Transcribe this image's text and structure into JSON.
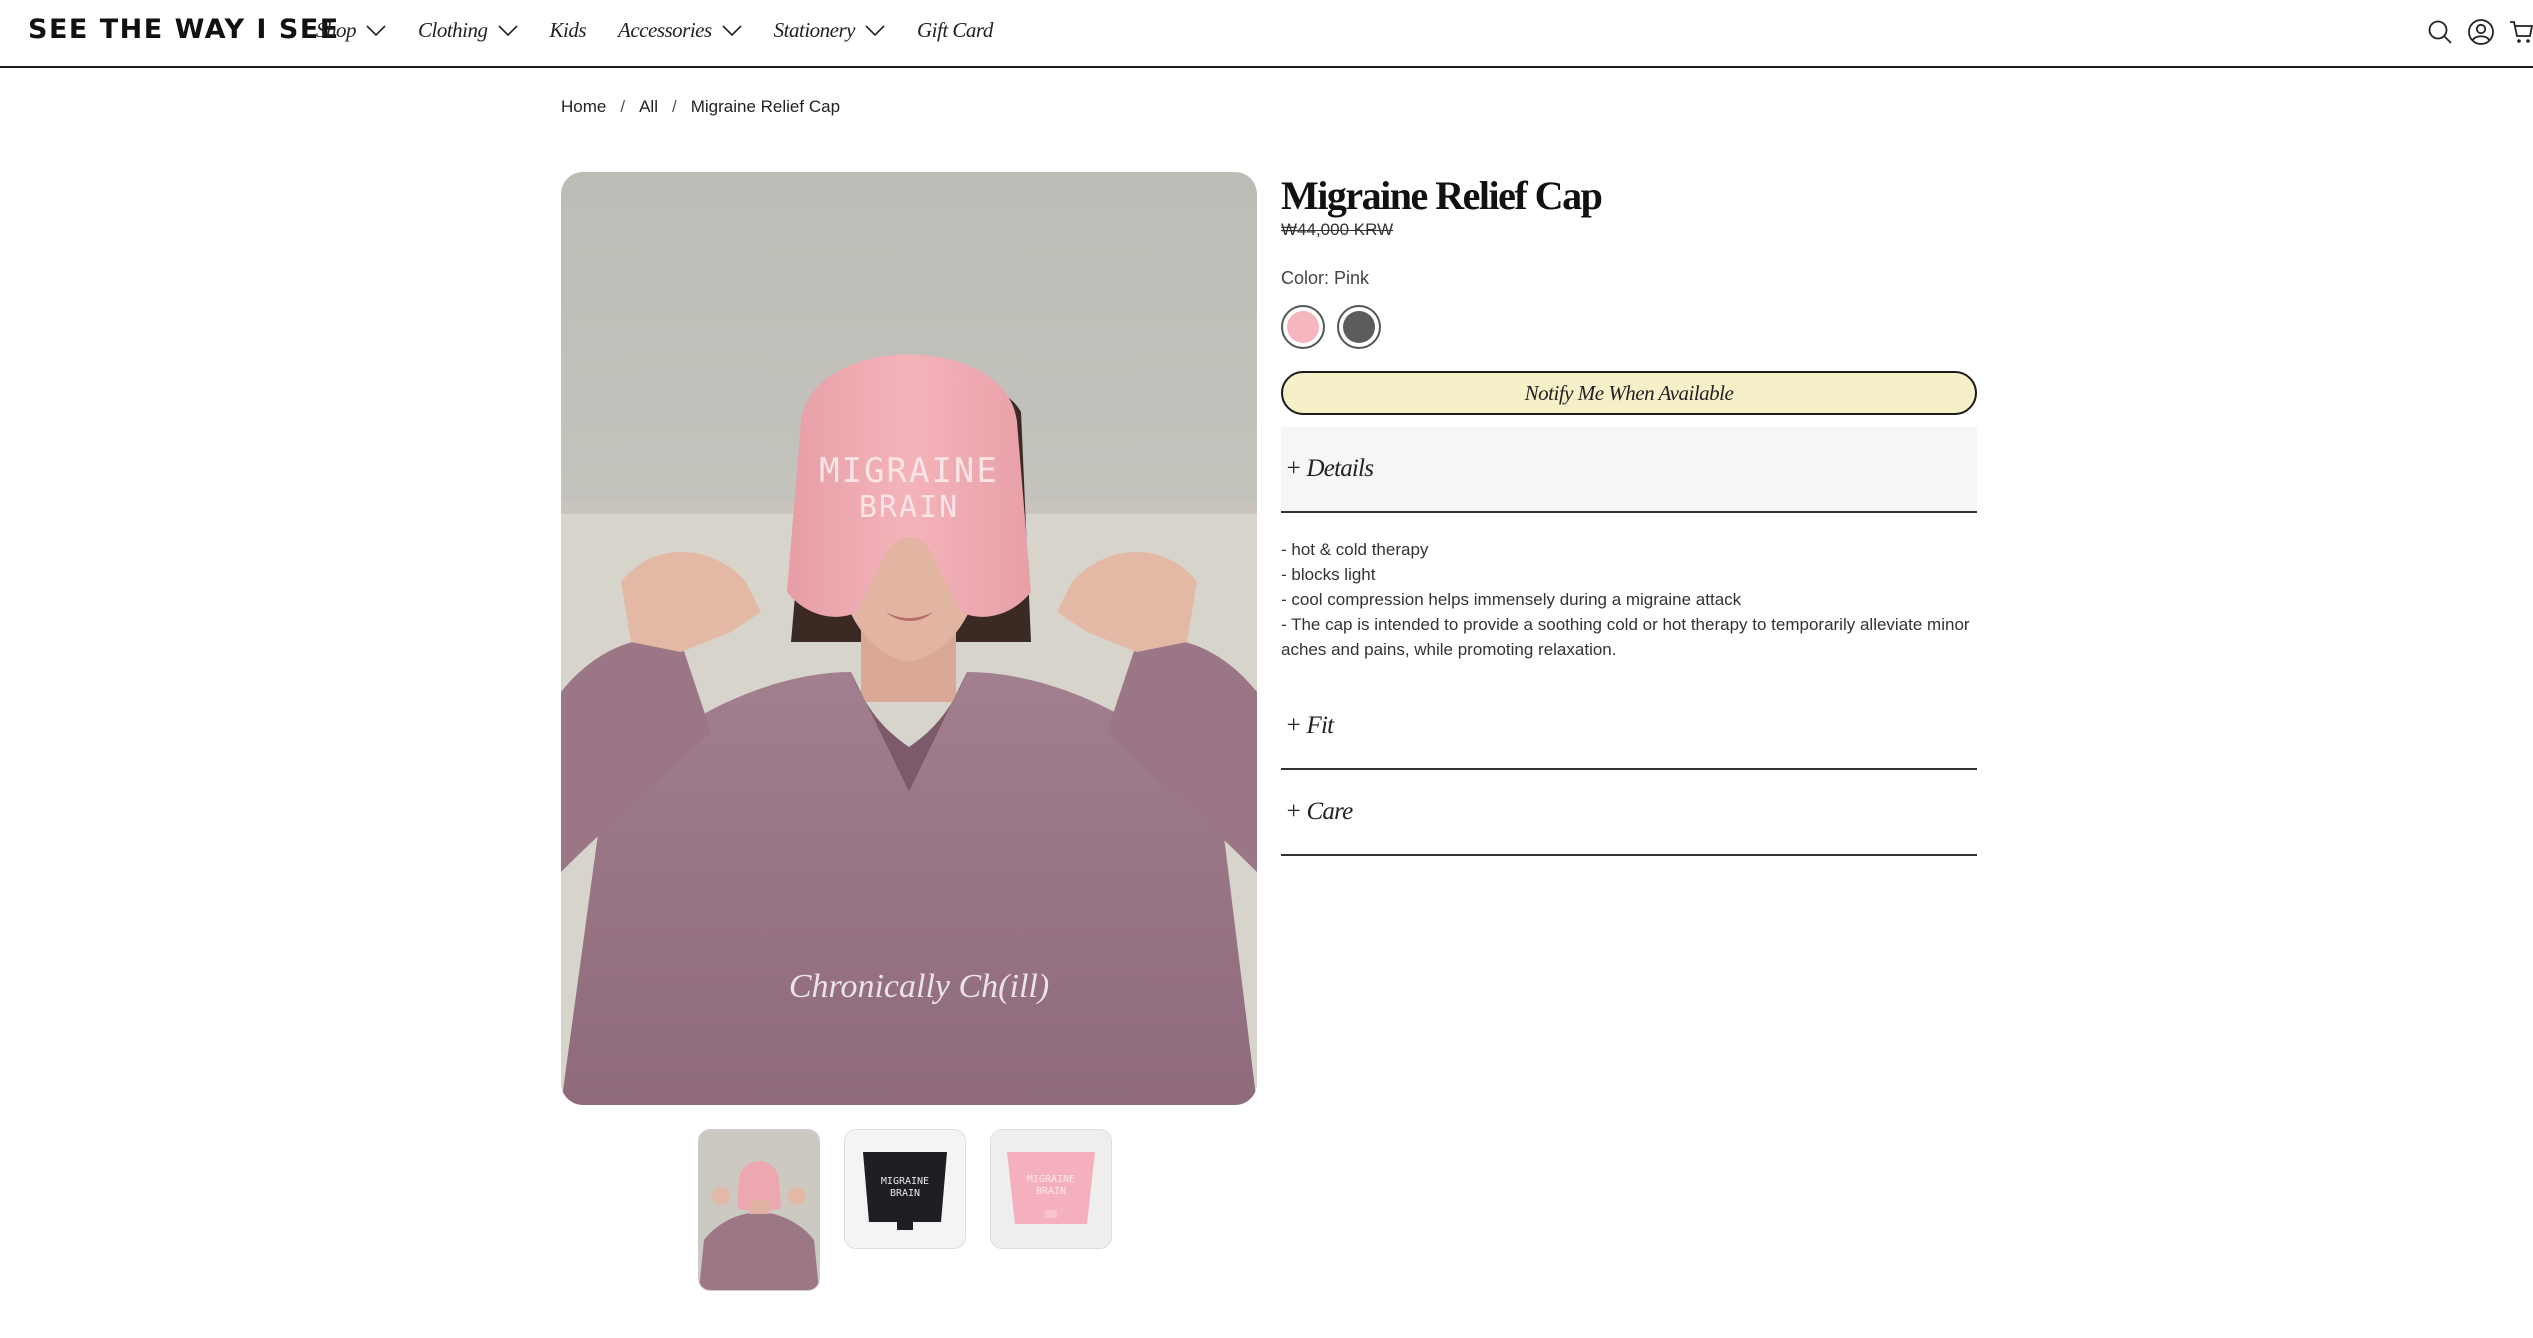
{
  "header": {
    "logo": "SEE THE WAY I SEE",
    "nav": [
      {
        "label": "Shop",
        "dropdown": true
      },
      {
        "label": "Clothing",
        "dropdown": true
      },
      {
        "label": "Kids",
        "dropdown": false
      },
      {
        "label": "Accessories",
        "dropdown": true
      },
      {
        "label": "Stationery",
        "dropdown": true
      },
      {
        "label": "Gift Card",
        "dropdown": false
      }
    ],
    "icons": [
      "search-icon",
      "account-icon",
      "cart-icon"
    ]
  },
  "breadcrumb": {
    "home": "Home",
    "all": "All",
    "current": "Migraine Relief Cap",
    "separator": "/"
  },
  "gallery": {
    "main_image": {
      "hoodie_text": "Chronically Ch(ill)",
      "cap_text_line1": "MIGRAINE",
      "cap_text_line2": "BRAIN"
    },
    "thumbnails": [
      {
        "kind": "model-photo",
        "color": "#e9a6ad"
      },
      {
        "kind": "black-cap",
        "color": "#1e1e24",
        "text1": "MIGRAINE",
        "text2": "BRAIN"
      },
      {
        "kind": "pink-cap",
        "color": "#f4b0bc",
        "text1": "MIGRAINE",
        "text2": "BRAIN"
      }
    ]
  },
  "product": {
    "title": "Migraine Relief Cap",
    "price": "₩44,000 KRW",
    "color_label": "Color: Pink",
    "swatches": [
      {
        "name": "Pink",
        "color": "#f6b6be",
        "selected": true
      },
      {
        "name": "Charcoal",
        "color": "#5c5c5c",
        "selected": false
      }
    ],
    "notify_button": "Notify Me When Available",
    "accordions": {
      "details": "+ Details",
      "fit": "+ Fit",
      "care": "+ Care"
    },
    "details_lines": [
      "- hot & cold therapy",
      "- blocks light",
      "- cool compression helps immensely during a migraine attack",
      "- The cap is intended to provide a soothing cold or hot therapy to temporarily alleviate minor aches and pains, while promoting relaxation."
    ]
  },
  "colors": {
    "notify_bg": "#f6f0c8",
    "border": "#1a1a1a",
    "details_bg": "#f6f6f6"
  }
}
